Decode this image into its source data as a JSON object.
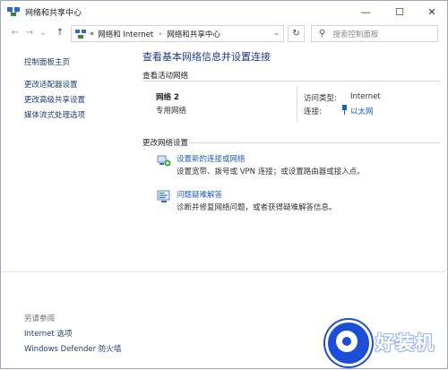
{
  "window": {
    "title": "网络和共享中心",
    "controls": {
      "minimize": "—",
      "maximize": "☐",
      "close": "✕"
    }
  },
  "nav": {
    "back": "←",
    "forward": "→",
    "recent": "⌄",
    "up": "↑",
    "breadcrumbs": [
      "«",
      "网络和 Internet",
      "网络和共享中心"
    ],
    "separator": "›",
    "dropdown": "⌄",
    "refresh": "↻",
    "search_placeholder": "搜索控制面板",
    "search_icon": "⚲"
  },
  "sidebar": {
    "home": "控制面板主页",
    "links": [
      "更改适配器设置",
      "更改高级共享设置",
      "媒体流式处理选项"
    ],
    "see_also_caption": "另请参阅",
    "see_also": [
      "Internet 选项",
      "Windows Defender 防火墙"
    ]
  },
  "main": {
    "heading": "查看基本网络信息并设置连接",
    "active_section": "查看活动网络",
    "network": {
      "name": "网络 2",
      "type": "专用网络",
      "access_key": "访问类型:",
      "access_value": "Internet",
      "conn_key": "连接:",
      "conn_value": "以太网"
    },
    "change_section": "更改网络设置",
    "tasks": [
      {
        "link": "设置新的连接或网络",
        "desc": "设置宽带、拨号或 VPN 连接；或设置路由器或接入点。",
        "icon": "network-setup-icon"
      },
      {
        "link": "问题疑难解答",
        "desc": "诊断并修复网络问题，或者获得疑难解答信息。",
        "icon": "troubleshoot-icon"
      }
    ]
  },
  "watermark": {
    "text": "好装机"
  },
  "colors": {
    "link": "#1c5fb8",
    "heading": "#1e3a8a",
    "watermark": "#1d4ed8"
  }
}
